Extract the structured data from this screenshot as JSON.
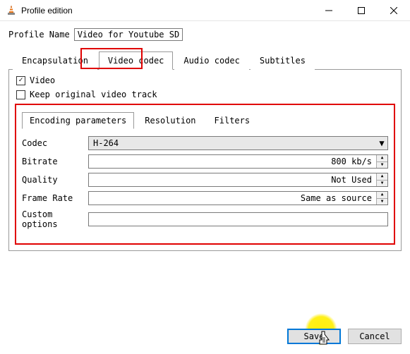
{
  "window": {
    "title": "Profile edition"
  },
  "profile": {
    "label": "Profile Name",
    "value": "Video for Youtube SD"
  },
  "tabs": {
    "encapsulation": "Encapsulation",
    "video_codec": "Video codec",
    "audio_codec": "Audio codec",
    "subtitles": "Subtitles"
  },
  "checks": {
    "video": "Video",
    "keep": "Keep original video track"
  },
  "inner_tabs": {
    "encoding": "Encoding parameters",
    "resolution": "Resolution",
    "filters": "Filters"
  },
  "fields": {
    "codec": {
      "label": "Codec",
      "value": "H-264"
    },
    "bitrate": {
      "label": "Bitrate",
      "value": "800 kb/s"
    },
    "quality": {
      "label": "Quality",
      "value": "Not Used"
    },
    "framerate": {
      "label": "Frame Rate",
      "value": "Same as source"
    },
    "custom": {
      "label": "Custom options",
      "value": ""
    }
  },
  "buttons": {
    "save": "Save",
    "cancel": "Cancel"
  }
}
